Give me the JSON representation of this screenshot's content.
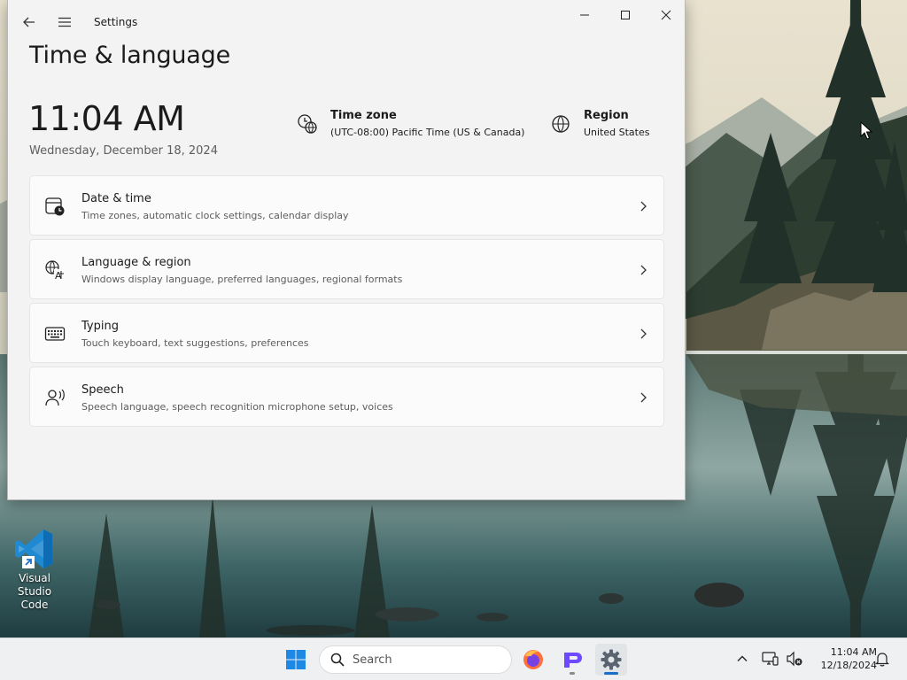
{
  "window": {
    "app_title": "Settings",
    "page_title": "Time & language"
  },
  "time_display": {
    "clock": "11:04 AM",
    "date": "Wednesday, December 18, 2024"
  },
  "info": {
    "timezone_title": "Time zone",
    "timezone_value": "(UTC-08:00) Pacific Time (US & Canada)",
    "region_title": "Region",
    "region_value": "United States"
  },
  "cards": [
    {
      "title": "Date & time",
      "subtitle": "Time zones, automatic clock settings, calendar display",
      "icon": "calendar-clock-icon"
    },
    {
      "title": "Language & region",
      "subtitle": "Windows display language, preferred languages, regional formats",
      "icon": "language-icon"
    },
    {
      "title": "Typing",
      "subtitle": "Touch keyboard, text suggestions, preferences",
      "icon": "keyboard-icon"
    },
    {
      "title": "Speech",
      "subtitle": "Speech language, speech recognition microphone setup, voices",
      "icon": "speech-icon"
    }
  ],
  "desktop": {
    "icon_label_line1": "Visual Studio",
    "icon_label_line2": "Code"
  },
  "taskbar": {
    "search_placeholder": "Search",
    "tray_time": "11:04 AM",
    "tray_date": "12/18/2024"
  },
  "colors": {
    "accent": "#1a6fc4",
    "window_bg": "#f3f3f3",
    "card_bg": "#fbfbfb",
    "taskbar_bg": "#eef0f2"
  }
}
